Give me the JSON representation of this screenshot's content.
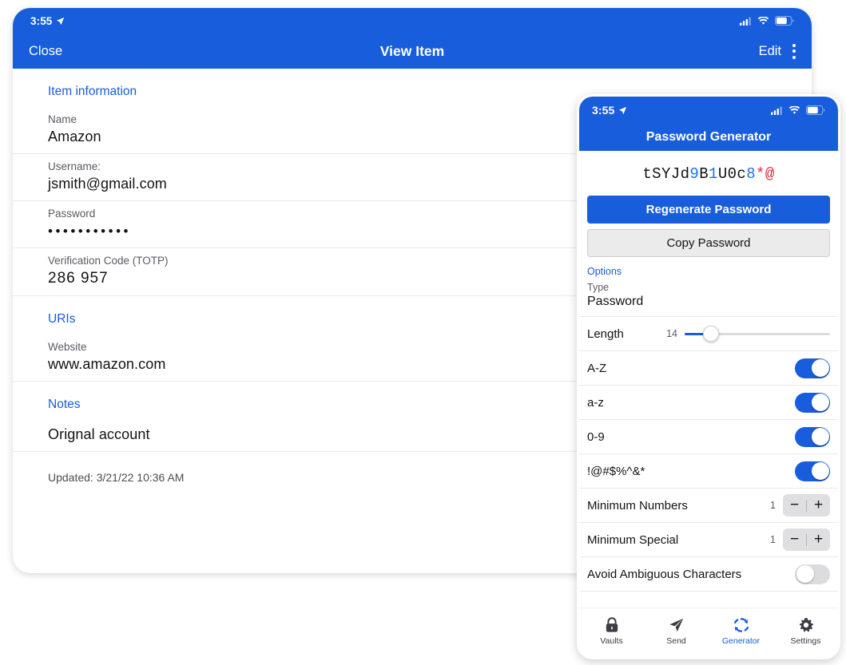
{
  "left_panel": {
    "status_bar": {
      "time": "3:55",
      "location_icon": "location-arrow-icon",
      "signal_icon": "cellular-signal-icon",
      "wifi_icon": "wifi-icon",
      "battery_icon": "battery-icon"
    },
    "nav": {
      "close_label": "Close",
      "title": "View Item",
      "edit_label": "Edit",
      "overflow_icon": "kebab-menu-icon"
    },
    "sections": {
      "item_information": {
        "heading": "Item information",
        "name_label": "Name",
        "name_value": "Amazon",
        "username_label": "Username:",
        "username_value": "jsmith@gmail.com",
        "password_label": "Password",
        "password_value": "•••••••••••",
        "totp_label": "Verification Code (TOTP)",
        "totp_value": "286  957"
      },
      "uris": {
        "heading": "URIs",
        "website_label": "Website",
        "website_value": "www.amazon.com"
      },
      "notes": {
        "heading": "Notes",
        "value": "Orignal account"
      },
      "updated": "Updated: 3/21/22 10:36 AM"
    }
  },
  "right_panel": {
    "status_bar": {
      "time": "3:55",
      "location_icon": "location-arrow-icon",
      "signal_icon": "cellular-signal-icon",
      "wifi_icon": "wifi-icon",
      "battery_icon": "battery-icon"
    },
    "title": "Password Generator",
    "generated_password": {
      "full": "tSYJd9B1U0c8*@",
      "segments": [
        {
          "text": "tSYJd",
          "kind": "letter"
        },
        {
          "text": "9",
          "kind": "number"
        },
        {
          "text": "B",
          "kind": "letter"
        },
        {
          "text": "1",
          "kind": "number"
        },
        {
          "text": "U0c",
          "kind": "letter"
        },
        {
          "text": "8",
          "kind": "number"
        },
        {
          "text": "*@",
          "kind": "symbol"
        }
      ]
    },
    "regenerate_label": "Regenerate Password",
    "copy_label": "Copy Password",
    "options_label": "Options",
    "type": {
      "label": "Type",
      "value": "Password"
    },
    "length": {
      "label": "Length",
      "value": "14",
      "percent": 18
    },
    "toggles": [
      {
        "label": "A-Z",
        "on": true
      },
      {
        "label": "a-z",
        "on": true
      },
      {
        "label": "0-9",
        "on": true
      },
      {
        "label": "!@#$%^&*",
        "on": true
      }
    ],
    "steppers": [
      {
        "label": "Minimum Numbers",
        "value": "1",
        "minus": "−",
        "plus": "+"
      },
      {
        "label": "Minimum Special",
        "value": "1",
        "minus": "−",
        "plus": "+"
      }
    ],
    "avoid_ambiguous": {
      "label": "Avoid Ambiguous Characters",
      "on": false
    },
    "tabs": [
      {
        "label": "Vaults",
        "icon": "lock-icon",
        "active": false
      },
      {
        "label": "Send",
        "icon": "paper-plane-icon",
        "active": false
      },
      {
        "label": "Generator",
        "icon": "refresh-icon",
        "active": true
      },
      {
        "label": "Settings",
        "icon": "gear-icon",
        "active": false
      }
    ]
  },
  "colors": {
    "brand_blue": "#175DDC",
    "number_blue": "#1d6ff2",
    "symbol_red": "#e4263a",
    "divider": "#e9e9ec"
  }
}
